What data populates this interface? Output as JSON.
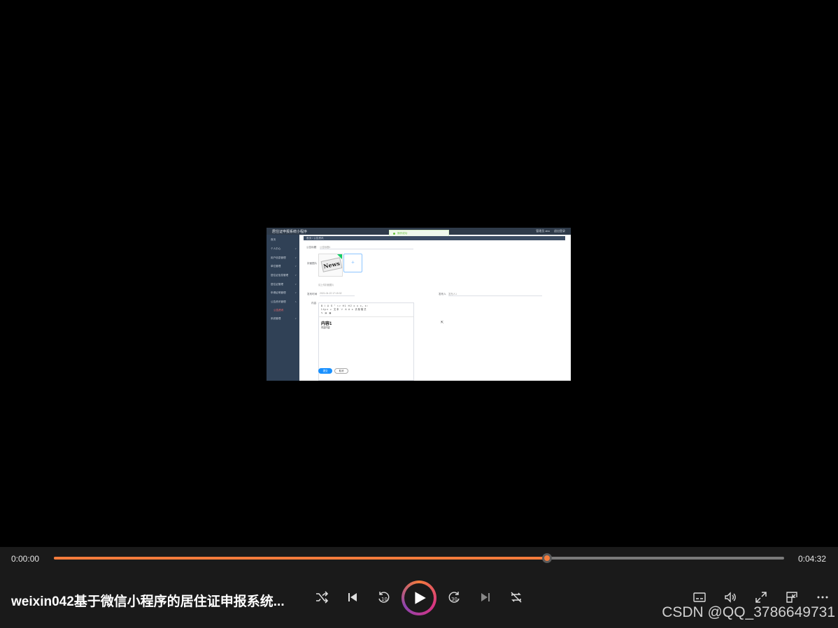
{
  "frame": {
    "app_title": "居住证申报系统小程序",
    "user_text": "管理员 abo",
    "logout": "退出登录",
    "toast": "操作成功",
    "breadcrumb": "首页 / 公告资讯",
    "sidebar": [
      {
        "label": "首页",
        "icon": "home-icon"
      },
      {
        "label": "个人中心",
        "icon": "user-icon"
      },
      {
        "label": "用户信息管理",
        "icon": "tag-icon"
      },
      {
        "label": "单位管理",
        "icon": "circle-icon"
      },
      {
        "label": "居住证信息管理",
        "icon": "circle-icon"
      },
      {
        "label": "居住证管理",
        "icon": "grid-icon"
      },
      {
        "label": "申请证明管理",
        "icon": "doc-icon"
      },
      {
        "label": "公告资讯管理",
        "icon": "doc-icon"
      },
      {
        "label": "公告资讯",
        "icon": "",
        "active": true
      },
      {
        "label": "系统管理",
        "icon": "gear-icon"
      }
    ],
    "form": {
      "title_label": "公告标题",
      "title_value": "公告标题1",
      "cover_label": "封面图片",
      "upload_tip": "请上传封面图片",
      "time_label": "发布时间",
      "time_value": "2021-04-22 17:15:32",
      "publisher_label": "发布人",
      "publisher_value": "发布人1",
      "content_label": "内容",
      "content_heading": "内容1",
      "content_text": "内容内容",
      "toolbar_row1": "B I U S  \"  <>  H1 H2  ≡ ≡  x₂ x²",
      "toolbar_row2": "14px  ∨  文本  ∨  A  A  ≡  清除格式",
      "toolbar_row3": "✎ ▤ ▦",
      "save": "提交",
      "cancel": "取消"
    }
  },
  "player": {
    "current_time": "0:00:00",
    "total_time": "0:04:32",
    "progress": 0.675,
    "title": "weixin042基于微信小程序的居住证申报系统...",
    "accent": "#f47b3c",
    "controls": [
      "shuffle-icon",
      "previous-icon",
      "rewind-10-icon",
      "play-icon",
      "forward-30-icon",
      "next-icon",
      "repeat-icon",
      "subtitles-icon",
      "volume-icon",
      "fullscreen-icon",
      "mini-player-icon",
      "more-icon"
    ]
  },
  "watermark": "CSDN @QQ_3786649731"
}
